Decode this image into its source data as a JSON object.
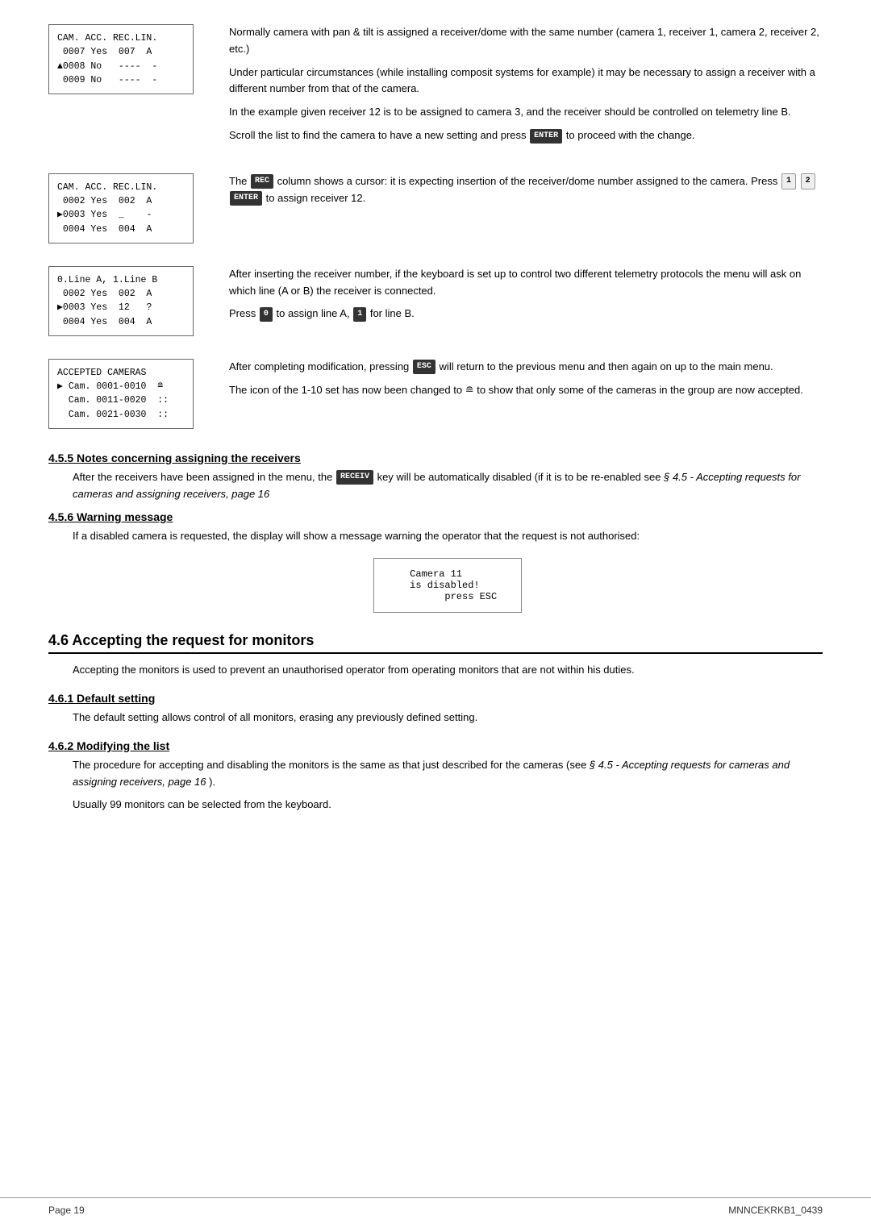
{
  "page": {
    "footer_left": "Page 19",
    "footer_right": "MNNCEKRKB1_0439"
  },
  "screens": {
    "screen1": {
      "lines": [
        "CAM. ACC. REC.LIN.",
        " 0007 Yes  007  A",
        "▂0008 No   ----  -",
        " 0009 No   ----  -"
      ]
    },
    "screen2": {
      "lines": [
        "CAM. ACC. REC.LIN.",
        " 0002 Yes  002  A",
        " 0003 Yes  _    -",
        " 0004 Yes  004  A"
      ],
      "arrow_row": 2
    },
    "screen3": {
      "lines": [
        "0.Line A, 1.Line B",
        " 0002 Yes  002  A",
        "▂0003 Yes  12   ?",
        " 0004 Yes  004  A"
      ]
    },
    "screen4": {
      "lines": [
        "ACCEPTED CAMERAS",
        "► Cam. 0001-0010  ≘",
        "  Cam. 0011-0020  ::",
        "  Cam. 0021-0030  ::"
      ]
    },
    "screen_disabled": {
      "lines": [
        "  Camera 11",
        "  is disabled!",
        "        press ESC"
      ]
    }
  },
  "section1": {
    "text1": "Normally camera with pan & tilt is assigned a receiver/dome with the same number (camera 1, receiver 1, camera 2, receiver 2, etc.)",
    "text2": "Under particular circumstances (while installing composit systems for example) it may be necessary to assign a receiver with a different number from that of the camera.",
    "text3": "In the example given receiver 12 is to be assigned to camera 3, and the receiver should be controlled on telemetry line B.",
    "text4": "Scroll the list to find the camera to have a new setting and press",
    "enter_label": "ENTER",
    "text5": "to proceed with the change."
  },
  "section2": {
    "text1": "The",
    "rec_label": "REC",
    "text2": "column shows a cursor: it is expecting insertion of the receiver/dome number assigned to the camera. Press",
    "key1": "1",
    "key2": "2",
    "enter_label": "ENTER",
    "text3": "to assign receiver 12."
  },
  "section3": {
    "text1": "After inserting the receiver number, if the keyboard is set up to control two different telemetry protocols the menu will ask on which line (A or B) the receiver is connected.",
    "text2": "Press",
    "key0": "0",
    "text3": "to assign line A,",
    "key1": "1",
    "text4": "for line B."
  },
  "section4": {
    "text1": "After completing modification, pressing",
    "esc_label": "ESC",
    "text2": "will return to the previous menu and then again on up to the main menu.",
    "text3": "The icon of the 1-10 set has now been changed to ≘ to show that only some of the cameras in the group are now accepted."
  },
  "section455": {
    "heading": "4.5.5 Notes concerning assigning the receivers",
    "text1": "After the receivers have been assigned in the menu, the",
    "receiv_label": "RECEIV",
    "text2": "key will be automatically disabled (if it is to be re-enabled see",
    "italic_ref": "§ 4.5 - Accepting requests for cameras and assigning receivers, page 16"
  },
  "section456": {
    "heading": "4.5.6 Warning message",
    "text1": "If a disabled camera is requested, the display will show a message warning the operator that the request is not authorised:"
  },
  "section46": {
    "heading": "4.6 Accepting  the request for monitors",
    "text1": "Accepting the monitors is used to prevent an unauthorised operator from operating monitors that are not within his duties."
  },
  "section461": {
    "heading": "4.6.1 Default setting",
    "text1": "The default setting allows control of all monitors, erasing any previously defined setting."
  },
  "section462": {
    "heading": "4.6.2 Modifying the list",
    "text1": "The procedure for accepting and disabling the monitors is the same as that just described for the cameras (see",
    "italic_ref": "§ 4.5 - Accepting requests for cameras and assigning receivers, page 16",
    "text2": ").",
    "text3": "Usually 99 monitors can be selected from the keyboard."
  }
}
